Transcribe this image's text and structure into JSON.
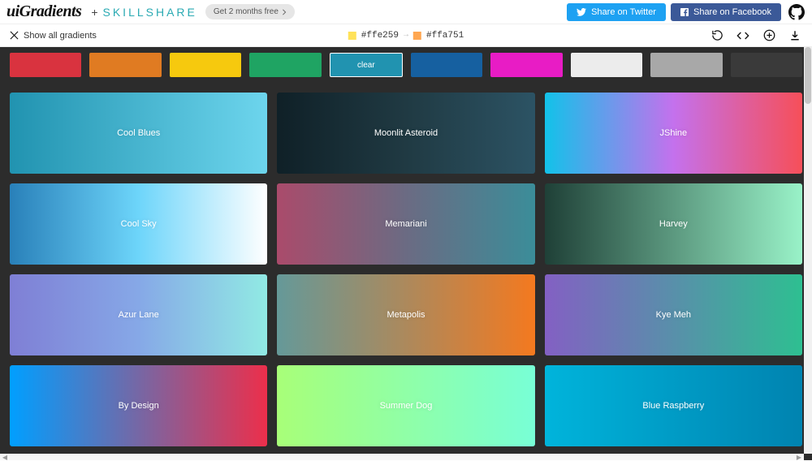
{
  "header": {
    "logo": "uiGradients",
    "partner": "SKILLSHARE",
    "cta": "Get 2 months free",
    "share_twitter": "Share on Twitter",
    "share_facebook": "Share on Facebook"
  },
  "toolbar": {
    "show_all": "Show all gradients",
    "color_a": "#ffe259",
    "color_b": "#ffa751"
  },
  "filters": [
    {
      "name": "red",
      "color": "#d9333f",
      "label": ""
    },
    {
      "name": "orange",
      "color": "#e07b22",
      "label": ""
    },
    {
      "name": "yellow",
      "color": "#f6c90e",
      "label": ""
    },
    {
      "name": "green",
      "color": "#1fa463",
      "label": ""
    },
    {
      "name": "teal",
      "color": "#2193b0",
      "label": "clear",
      "active": true
    },
    {
      "name": "blue",
      "color": "#1660a0",
      "label": ""
    },
    {
      "name": "pink",
      "color": "#e81cc5",
      "label": ""
    },
    {
      "name": "light",
      "color": "#ececec",
      "label": ""
    },
    {
      "name": "grey",
      "color": "#a8a8a8",
      "label": ""
    },
    {
      "name": "dark",
      "color": "#3a3a3a",
      "label": ""
    }
  ],
  "gradients": [
    {
      "name": "Cool Blues",
      "css": "linear-gradient(90deg,#2193b0,#6dd5ed)"
    },
    {
      "name": "Moonlit Asteroid",
      "css": "linear-gradient(90deg,#0f2027,#203a43,#2c5364)"
    },
    {
      "name": "JShine",
      "css": "linear-gradient(90deg,#12c2e9,#c471ed,#f64f59)"
    },
    {
      "name": "Cool Sky",
      "css": "linear-gradient(90deg,#2980b9,#6dd5fa,#ffffff)"
    },
    {
      "name": "Memariani",
      "css": "linear-gradient(90deg,#aa4b6b,#6b6b83,#3b8d99)"
    },
    {
      "name": "Harvey",
      "css": "linear-gradient(90deg,#1f4037,#99f2c8)"
    },
    {
      "name": "Azur Lane",
      "css": "linear-gradient(90deg,#7f7fd5,#86a8e7,#91eae4)"
    },
    {
      "name": "Metapolis",
      "css": "linear-gradient(90deg,#659999,#f4791f)"
    },
    {
      "name": "Kye Meh",
      "css": "linear-gradient(90deg,#8360c3,#2ebf91)"
    },
    {
      "name": "By Design",
      "css": "linear-gradient(90deg,#009FFF,#ec2F4B)"
    },
    {
      "name": "Summer Dog",
      "css": "linear-gradient(90deg,#a8ff78,#78ffd6)"
    },
    {
      "name": "Blue Raspberry",
      "css": "linear-gradient(90deg,#00b4db,#0083b0)"
    }
  ]
}
